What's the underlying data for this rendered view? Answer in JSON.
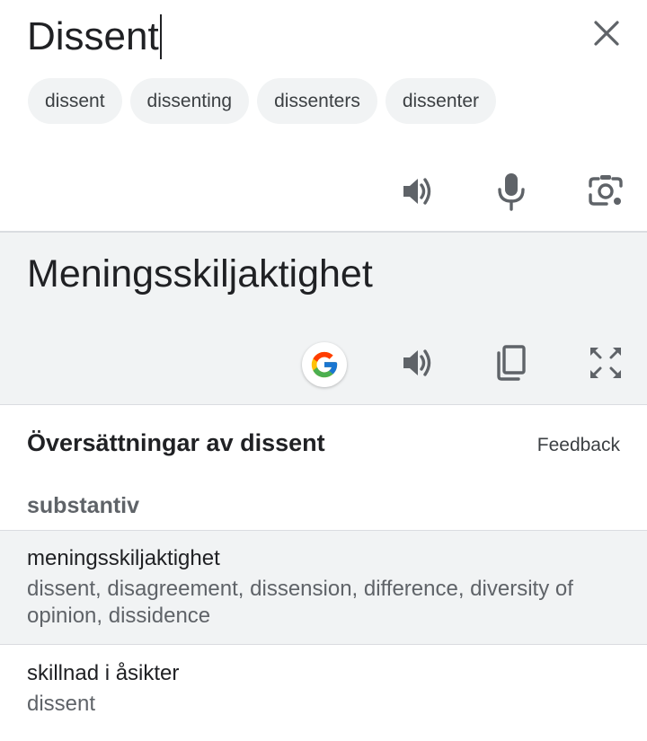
{
  "source": {
    "text": "Dissent",
    "close_icon": "close-icon",
    "suggestions": [
      "dissent",
      "dissenting",
      "dissenters",
      "dissenter"
    ],
    "actions": {
      "listen_icon": "volume-icon",
      "mic_icon": "microphone-icon",
      "camera_icon": "camera-lens-icon"
    }
  },
  "target": {
    "text": "Meningsskiljaktighet",
    "actions": {
      "google_icon": "google-logo-icon",
      "listen_icon": "volume-icon",
      "copy_icon": "copy-icon",
      "fullscreen_icon": "fullscreen-icon"
    }
  },
  "dictionary": {
    "title": "Översättningar av dissent",
    "feedback": "Feedback",
    "part_of_speech": "substantiv",
    "entries": [
      {
        "word": "meningsskiljaktighet",
        "synonyms": "dissent, disagreement, dissension, difference, diversity of opinion, dissidence"
      },
      {
        "word": "skillnad i åsikter",
        "synonyms": "dissent"
      }
    ]
  },
  "colors": {
    "panel_gray": "#f1f3f4",
    "icon_gray": "#5f6368",
    "text": "#202124",
    "divider": "#dadce0"
  }
}
